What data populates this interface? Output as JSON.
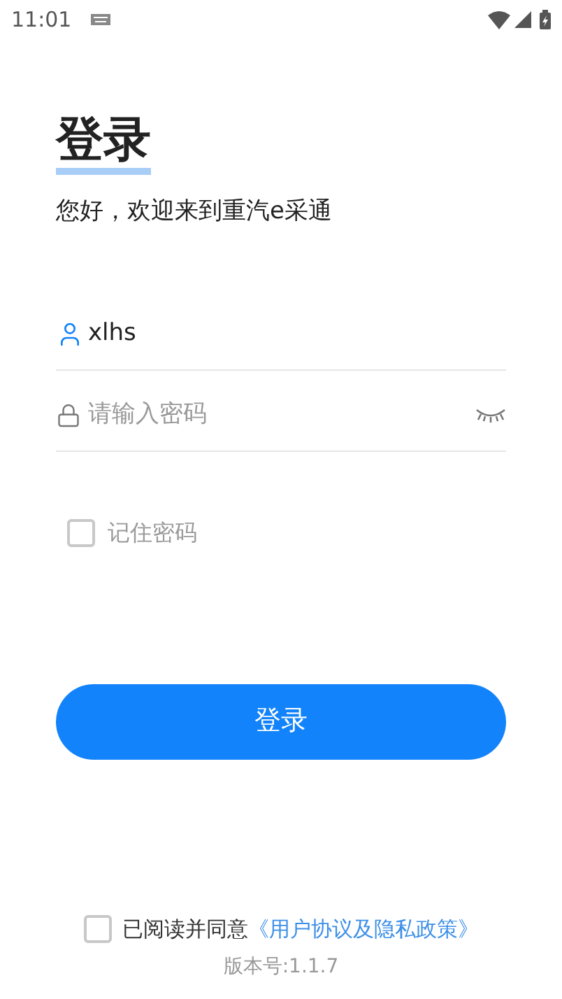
{
  "status_bar": {
    "time": "11:01"
  },
  "title": "登录",
  "subtitle": "您好，欢迎来到重汽e采通",
  "username": {
    "value": "xlhs"
  },
  "password": {
    "placeholder": "请输入密码"
  },
  "remember": {
    "label": "记住密码",
    "checked": false
  },
  "login_button": "登录",
  "agreement": {
    "text": "已阅读并同意",
    "link": "《用户协议及隐私政策》",
    "checked": false
  },
  "version": "版本号:1.1.7"
}
